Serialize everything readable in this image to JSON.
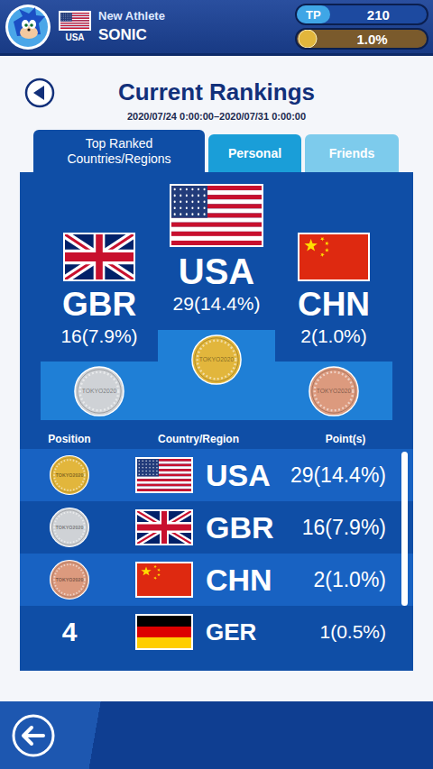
{
  "header": {
    "country": "USA",
    "flag": "us",
    "title": "New Athlete",
    "name": "SONIC",
    "tp": {
      "label": "TP",
      "value": "210"
    },
    "medal_share": "1.0%"
  },
  "page": {
    "title": "Current Rankings",
    "period": "2020/07/24 0:00:00–2020/07/31 0:00:00"
  },
  "tabs": [
    {
      "label": "Top Ranked Countries/Regions",
      "selected": true,
      "color": "#0f4ea6"
    },
    {
      "label": "Personal",
      "selected": false,
      "color": "#1a9ed8"
    },
    {
      "label": "Friends",
      "selected": false,
      "color": "#7dcbec"
    }
  ],
  "medal_text": "TOKYO2020",
  "podium": [
    {
      "country": "GBR",
      "flag": "gb",
      "points": "16(7.9%)",
      "kind": "side",
      "color": "#cfd2d6"
    },
    {
      "country": "USA",
      "flag": "us",
      "points": "29(14.4%)",
      "kind": "center",
      "color": "#e2b63c"
    },
    {
      "country": "CHN",
      "flag": "cn",
      "points": "2(1.0%)",
      "kind": "side",
      "color": "#dc9a7e"
    }
  ],
  "table": {
    "columns": [
      "Position",
      "Country/Region",
      "Point(s)"
    ],
    "rows": [
      {
        "kind": "medal",
        "position": "",
        "color": "#e2b63c",
        "country": "USA",
        "flag": "us",
        "points": "29(14.4%)"
      },
      {
        "kind": "medal",
        "position": "",
        "color": "#cfd2d6",
        "country": "GBR",
        "flag": "gb",
        "points": "16(7.9%)"
      },
      {
        "kind": "medal",
        "position": "",
        "color": "#dc9a7e",
        "country": "CHN",
        "flag": "cn",
        "points": "2(1.0%)"
      },
      {
        "kind": "number",
        "position": "4",
        "color": "",
        "country": "GER",
        "flag": "de",
        "points": "1(0.5%)"
      }
    ],
    "scroll_level": 0.7
  }
}
